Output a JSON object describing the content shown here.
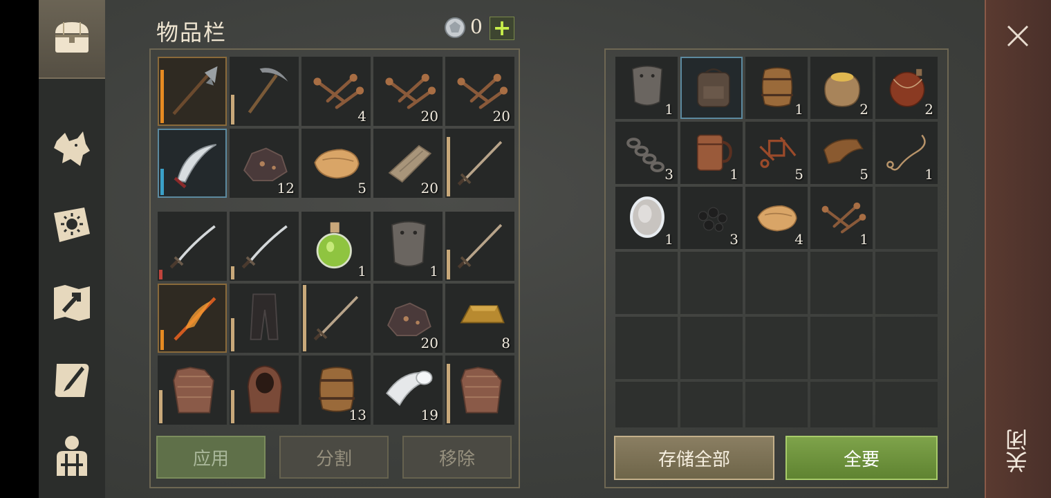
{
  "inventory": {
    "title": "物品栏",
    "currency_count": "0",
    "currency_icon": "silver-coin-icon",
    "add_label": "+",
    "bag_slots": [
      {
        "icon": "halberd-icon",
        "qty": "",
        "bar": "orange",
        "bar_level": 0.8,
        "selected": "orange"
      },
      {
        "icon": "pickaxe-icon",
        "qty": "",
        "bar": "tan",
        "bar_level": 0.45,
        "selected": ""
      },
      {
        "icon": "nails-icon",
        "qty": "4",
        "bar": "",
        "bar_level": 0,
        "selected": ""
      },
      {
        "icon": "nails-icon",
        "qty": "20",
        "bar": "",
        "bar_level": 0,
        "selected": ""
      },
      {
        "icon": "nails-icon",
        "qty": "20",
        "bar": "",
        "bar_level": 0,
        "selected": ""
      },
      {
        "icon": "scimitar-icon",
        "qty": "",
        "bar": "blue",
        "bar_level": 0.4,
        "selected": "blue"
      },
      {
        "icon": "iron-ore-icon",
        "qty": "12",
        "bar": "",
        "bar_level": 0,
        "selected": ""
      },
      {
        "icon": "cloth-icon",
        "qty": "5",
        "bar": "",
        "bar_level": 0,
        "selected": ""
      },
      {
        "icon": "plank-icon",
        "qty": "20",
        "bar": "",
        "bar_level": 0,
        "selected": ""
      },
      {
        "icon": "sword-icon",
        "qty": "",
        "bar": "tan",
        "bar_level": 0.9,
        "selected": ""
      }
    ],
    "pack_slots": [
      {
        "icon": "saber-icon",
        "qty": "",
        "bar": "red",
        "bar_level": 0.15,
        "selected": ""
      },
      {
        "icon": "saber-icon",
        "qty": "",
        "bar": "tan",
        "bar_level": 0.2,
        "selected": ""
      },
      {
        "icon": "potion-icon",
        "qty": "1",
        "bar": "",
        "bar_level": 0,
        "selected": ""
      },
      {
        "icon": "shield-plate-icon",
        "qty": "1",
        "bar": "",
        "bar_level": 0,
        "selected": ""
      },
      {
        "icon": "sword-icon",
        "qty": "",
        "bar": "tan",
        "bar_level": 0.45,
        "selected": ""
      },
      {
        "icon": "flame-sword-icon",
        "qty": "",
        "bar": "orange",
        "bar_level": 0.3,
        "selected": "orange"
      },
      {
        "icon": "pants-icon",
        "qty": "",
        "bar": "tan",
        "bar_level": 0.5,
        "selected": ""
      },
      {
        "icon": "sword-icon",
        "qty": "",
        "bar": "tan",
        "bar_level": 1.0,
        "selected": ""
      },
      {
        "icon": "iron-ore-icon",
        "qty": "20",
        "bar": "",
        "bar_level": 0,
        "selected": ""
      },
      {
        "icon": "gold-ingot-icon",
        "qty": "8",
        "bar": "",
        "bar_level": 0,
        "selected": ""
      },
      {
        "icon": "chainmail-icon",
        "qty": "",
        "bar": "tan",
        "bar_level": 0.5,
        "selected": ""
      },
      {
        "icon": "hood-icon",
        "qty": "",
        "bar": "tan",
        "bar_level": 0.5,
        "selected": ""
      },
      {
        "icon": "barrel-icon",
        "qty": "13",
        "bar": "",
        "bar_level": 0,
        "selected": ""
      },
      {
        "icon": "bandage-roll-icon",
        "qty": "19",
        "bar": "",
        "bar_level": 0,
        "selected": ""
      },
      {
        "icon": "chainmail-icon",
        "qty": "",
        "bar": "tan",
        "bar_level": 0.9,
        "selected": ""
      }
    ],
    "buttons": {
      "apply": "应用",
      "split": "分割",
      "remove": "移除"
    }
  },
  "storage": {
    "slots": [
      {
        "icon": "shield-plate-icon",
        "qty": "1",
        "selected": ""
      },
      {
        "icon": "backpack-icon",
        "qty": "",
        "selected": "blue"
      },
      {
        "icon": "barrel-icon",
        "qty": "1",
        "selected": ""
      },
      {
        "icon": "grain-sack-icon",
        "qty": "2",
        "selected": ""
      },
      {
        "icon": "waterskin-icon",
        "qty": "2",
        "selected": ""
      },
      {
        "icon": "chain-icon",
        "qty": "3",
        "selected": ""
      },
      {
        "icon": "mug-icon",
        "qty": "1",
        "selected": ""
      },
      {
        "icon": "scrap-metal-icon",
        "qty": "5",
        "selected": ""
      },
      {
        "icon": "leather-icon",
        "qty": "5",
        "selected": ""
      },
      {
        "icon": "rope-icon",
        "qty": "1",
        "selected": ""
      },
      {
        "icon": "mirror-icon",
        "qty": "1",
        "selected": ""
      },
      {
        "icon": "coal-icon",
        "qty": "3",
        "selected": ""
      },
      {
        "icon": "cloth-icon",
        "qty": "4",
        "selected": ""
      },
      {
        "icon": "nails-icon",
        "qty": "1",
        "selected": ""
      },
      {
        "icon": "",
        "qty": "",
        "selected": ""
      },
      {
        "icon": "",
        "qty": "",
        "selected": ""
      },
      {
        "icon": "",
        "qty": "",
        "selected": ""
      },
      {
        "icon": "",
        "qty": "",
        "selected": ""
      },
      {
        "icon": "",
        "qty": "",
        "selected": ""
      },
      {
        "icon": "",
        "qty": "",
        "selected": ""
      },
      {
        "icon": "",
        "qty": "",
        "selected": ""
      },
      {
        "icon": "",
        "qty": "",
        "selected": ""
      },
      {
        "icon": "",
        "qty": "",
        "selected": ""
      },
      {
        "icon": "",
        "qty": "",
        "selected": ""
      },
      {
        "icon": "",
        "qty": "",
        "selected": ""
      },
      {
        "icon": "",
        "qty": "",
        "selected": ""
      },
      {
        "icon": "",
        "qty": "",
        "selected": ""
      },
      {
        "icon": "",
        "qty": "",
        "selected": ""
      },
      {
        "icon": "",
        "qty": "",
        "selected": ""
      },
      {
        "icon": "",
        "qty": "",
        "selected": ""
      }
    ],
    "buttons": {
      "store_all": "存储全部",
      "take_all": "全要"
    }
  },
  "nav": [
    {
      "icon": "chest-icon",
      "active": true
    },
    {
      "icon": "wolf-icon",
      "active": false
    },
    {
      "icon": "sun-book-icon",
      "active": false
    },
    {
      "icon": "map-icon",
      "active": false
    },
    {
      "icon": "quest-scroll-icon",
      "active": false
    },
    {
      "icon": "character-icon",
      "active": false
    }
  ],
  "close": {
    "label": "关闭",
    "icon": "close-icon"
  },
  "colors": {
    "accent_green": "#7ea34a",
    "frame": "#6e6753",
    "durability_orange": "#e58a22",
    "durability_blue": "#3aa0c8"
  }
}
